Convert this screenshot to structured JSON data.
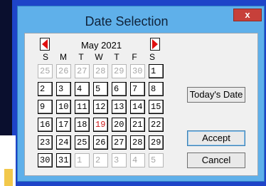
{
  "window": {
    "title": "Date Selection",
    "close_label": "x"
  },
  "calendar": {
    "month_label": "May 2021",
    "prev_icon": "arrow-left-icon",
    "next_icon": "arrow-right-icon",
    "arrow_color": "#e01010",
    "days_of_week": [
      "S",
      "M",
      "T",
      "W",
      "T",
      "F",
      "S"
    ],
    "weeks": [
      [
        {
          "d": "25",
          "t": "other"
        },
        {
          "d": "26",
          "t": "other"
        },
        {
          "d": "27",
          "t": "other"
        },
        {
          "d": "28",
          "t": "other"
        },
        {
          "d": "29",
          "t": "other"
        },
        {
          "d": "30",
          "t": "other"
        },
        {
          "d": "1",
          "t": "cur"
        }
      ],
      [
        {
          "d": "2",
          "t": "cur"
        },
        {
          "d": "3",
          "t": "cur"
        },
        {
          "d": "4",
          "t": "cur"
        },
        {
          "d": "5",
          "t": "cur"
        },
        {
          "d": "6",
          "t": "cur"
        },
        {
          "d": "7",
          "t": "cur"
        },
        {
          "d": "8",
          "t": "cur"
        }
      ],
      [
        {
          "d": "9",
          "t": "cur"
        },
        {
          "d": "10",
          "t": "cur"
        },
        {
          "d": "11",
          "t": "cur"
        },
        {
          "d": "12",
          "t": "cur"
        },
        {
          "d": "13",
          "t": "cur"
        },
        {
          "d": "14",
          "t": "cur"
        },
        {
          "d": "15",
          "t": "cur"
        }
      ],
      [
        {
          "d": "16",
          "t": "cur"
        },
        {
          "d": "17",
          "t": "cur"
        },
        {
          "d": "18",
          "t": "cur"
        },
        {
          "d": "19",
          "t": "today"
        },
        {
          "d": "20",
          "t": "cur"
        },
        {
          "d": "21",
          "t": "cur"
        },
        {
          "d": "22",
          "t": "cur"
        }
      ],
      [
        {
          "d": "23",
          "t": "cur"
        },
        {
          "d": "24",
          "t": "cur"
        },
        {
          "d": "25",
          "t": "cur"
        },
        {
          "d": "26",
          "t": "cur"
        },
        {
          "d": "27",
          "t": "cur"
        },
        {
          "d": "28",
          "t": "cur"
        },
        {
          "d": "29",
          "t": "cur"
        }
      ],
      [
        {
          "d": "30",
          "t": "cur"
        },
        {
          "d": "31",
          "t": "cur"
        },
        {
          "d": "1",
          "t": "other"
        },
        {
          "d": "2",
          "t": "other"
        },
        {
          "d": "3",
          "t": "other"
        },
        {
          "d": "4",
          "t": "other"
        },
        {
          "d": "5",
          "t": "other"
        }
      ]
    ]
  },
  "buttons": {
    "today_label": "Today's Date",
    "accept_label": "Accept",
    "cancel_label": "Cancel"
  }
}
